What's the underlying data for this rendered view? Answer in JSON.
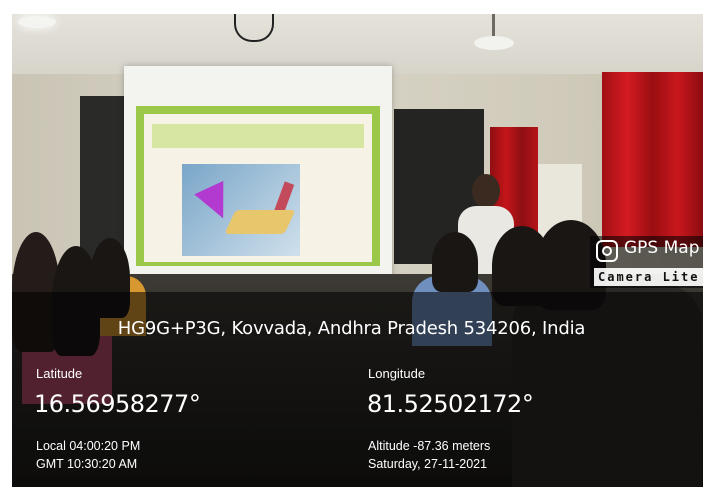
{
  "badge": {
    "title": "GPS Map",
    "subtitle": "Camera Lite",
    "logo_icon": "camera-icon"
  },
  "location": {
    "address": "HG9G+P3G, Kovvada, Andhra Pradesh 534206, India"
  },
  "coordinates": {
    "latitude_label": "Latitude",
    "latitude_value": "16.56958277°",
    "longitude_label": "Longitude",
    "longitude_value": "81.52502172°"
  },
  "details": {
    "local_time": "Local 04:00:20 PM",
    "gmt_time": "GMT 10:30:20 AM",
    "altitude": "Altitude -87.36 meters",
    "date": "Saturday, 27-11-2021"
  },
  "colors": {
    "overlay": "#000000",
    "text": "#ffffff",
    "slide_border": "#9cc84a",
    "curtain": "#c4151a"
  }
}
